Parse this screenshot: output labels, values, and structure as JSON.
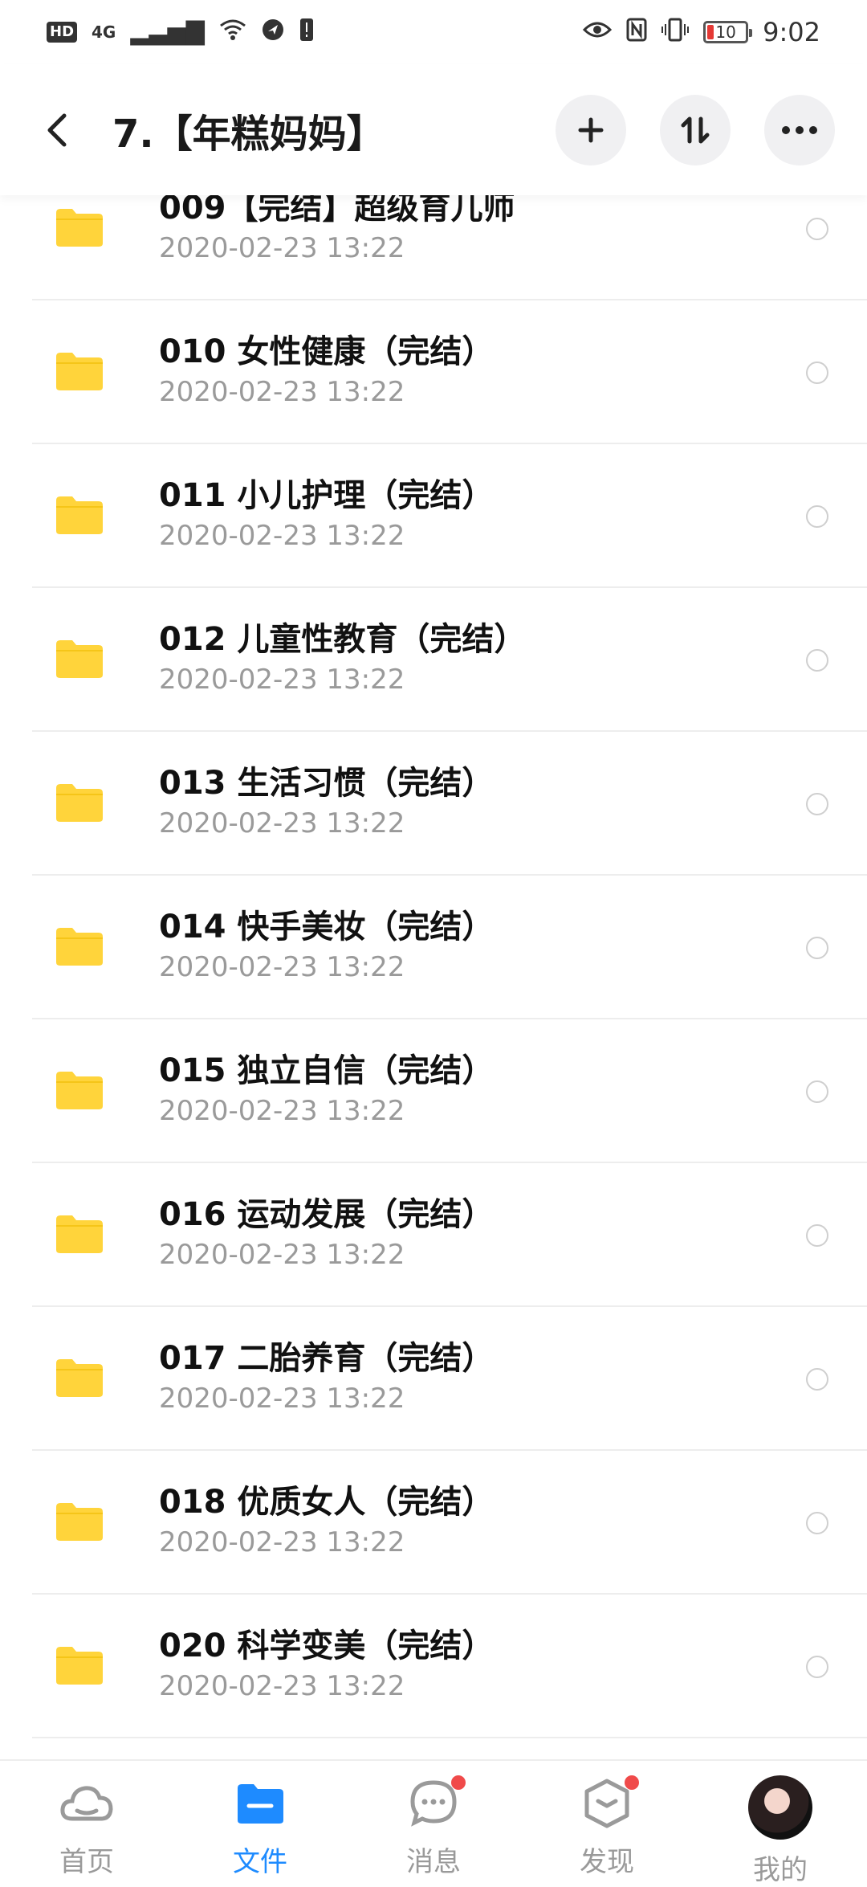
{
  "status_bar": {
    "hd": "HD",
    "network": "4G",
    "battery": "10",
    "time": "9:02"
  },
  "header": {
    "title": "7.【年糕妈妈】",
    "back_icon": "chevron-left-icon",
    "add_icon": "plus-icon",
    "sort_icon": "sort-icon",
    "more_icon": "more-horizontal-icon"
  },
  "files": [
    {
      "name": "009【完结】超级育儿师",
      "date": "2020-02-23  13:22"
    },
    {
      "name": "010 女性健康（完结）",
      "date": "2020-02-23  13:22"
    },
    {
      "name": "011 小儿护理（完结）",
      "date": "2020-02-23  13:22"
    },
    {
      "name": "012 儿童性教育（完结）",
      "date": "2020-02-23  13:22"
    },
    {
      "name": "013 生活习惯（完结）",
      "date": "2020-02-23  13:22"
    },
    {
      "name": "014 快手美妆（完结）",
      "date": "2020-02-23  13:22"
    },
    {
      "name": "015 独立自信（完结）",
      "date": "2020-02-23  13:22"
    },
    {
      "name": "016 运动发展（完结）",
      "date": "2020-02-23  13:22"
    },
    {
      "name": "017 二胎养育（完结）",
      "date": "2020-02-23  13:22"
    },
    {
      "name": "018 优质女人（完结）",
      "date": "2020-02-23  13:22"
    },
    {
      "name": "020 科学变美（完结）",
      "date": "2020-02-23  13:22"
    }
  ],
  "nav": {
    "home": "首页",
    "files": "文件",
    "messages": "消息",
    "discover": "发现",
    "mine": "我的"
  },
  "colors": {
    "accent": "#1e8bff",
    "folder": "#ffd43b",
    "badge": "#f04a4a"
  }
}
